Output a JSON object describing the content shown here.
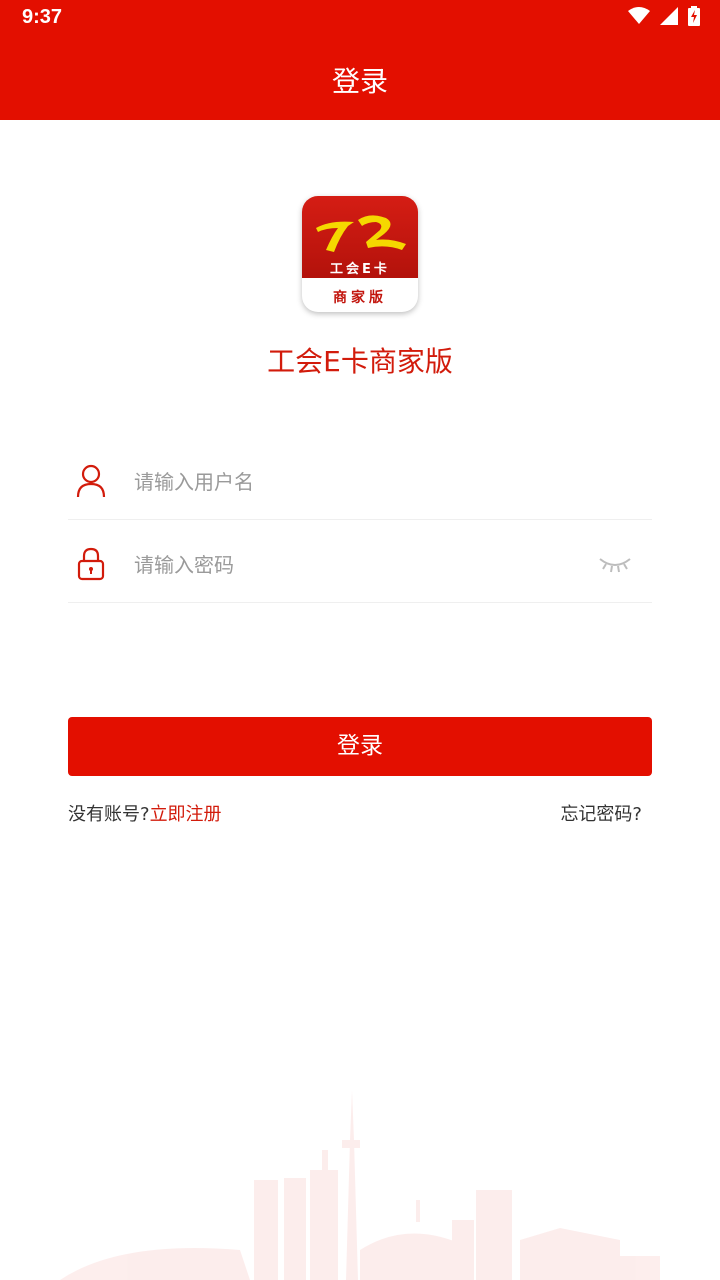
{
  "status_bar": {
    "time": "9:37",
    "icons": [
      "wifi-icon",
      "signal-icon",
      "battery-charging-icon"
    ]
  },
  "header": {
    "title": "登录"
  },
  "logo": {
    "top_text": "工会E卡",
    "bottom_text": "商家版"
  },
  "app_name": "工会E卡商家版",
  "form": {
    "username_placeholder": "请输入用户名",
    "password_placeholder": "请输入密码",
    "username_icon": "user-icon",
    "password_icon": "lock-icon",
    "visibility_icon": "eye-closed-icon"
  },
  "login_button": "登录",
  "links": {
    "no_account": "没有账号?",
    "register": "立即注册",
    "forgot": "忘记密码?"
  },
  "colors": {
    "primary": "#e30f00",
    "accent_text": "#d21b0b"
  }
}
